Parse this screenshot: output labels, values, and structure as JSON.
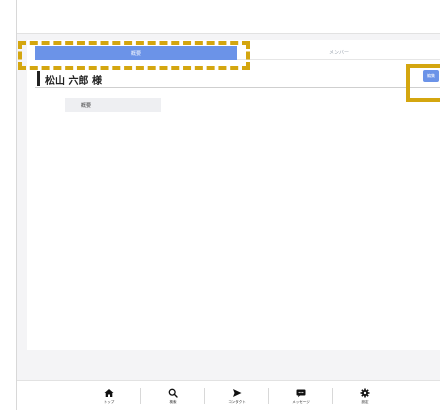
{
  "tabs": [
    {
      "label": "概要"
    },
    {
      "label": "メンバー"
    }
  ],
  "profile": {
    "name": "松山 六郎 様",
    "edit_label": "編集",
    "summary_label": "概要"
  },
  "bottom_nav": {
    "items": [
      {
        "label": "トップ",
        "icon": "home-icon"
      },
      {
        "label": "検索",
        "icon": "search-icon"
      },
      {
        "label": "コンタクト",
        "icon": "send-icon"
      },
      {
        "label": "メッセージ",
        "icon": "message-icon"
      },
      {
        "label": "設定",
        "icon": "gear-icon"
      }
    ]
  },
  "colors": {
    "accent": "#6b93e8",
    "highlight": "#d4a60f"
  }
}
